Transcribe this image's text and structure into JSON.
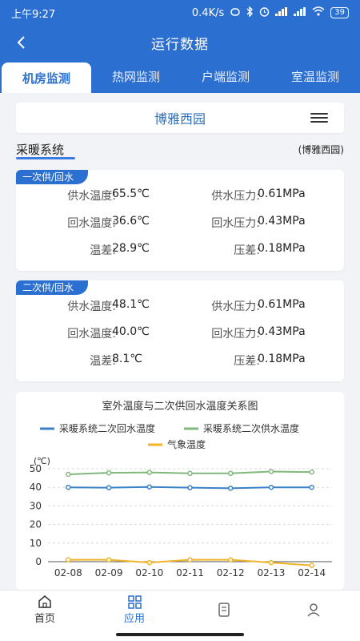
{
  "status": {
    "time": "上午9:27",
    "speed": "0.4K/s",
    "battery": "39"
  },
  "header": {
    "title": "运行数据"
  },
  "tabs": [
    {
      "label": "机房监测",
      "active": true
    },
    {
      "label": "热网监测",
      "active": false
    },
    {
      "label": "户端监测",
      "active": false
    },
    {
      "label": "室温监测",
      "active": false
    }
  ],
  "station": {
    "name": "博雅西园"
  },
  "section": {
    "title": "采暖系统",
    "station_tag": "(博雅西园)"
  },
  "primary": {
    "label": "一次供/回水",
    "supply_temp_label": "供水温度:",
    "supply_temp": "65.5℃",
    "supply_press_label": "供水压力:",
    "supply_press": "0.61MPa",
    "return_temp_label": "回水温度:",
    "return_temp": "36.6℃",
    "return_press_label": "回水压力:",
    "return_press": "0.43MPa",
    "diff_temp_label": "温差:",
    "diff_temp": "28.9℃",
    "diff_press_label": "压差:",
    "diff_press": "0.18MPa"
  },
  "secondary": {
    "label": "二次供/回水",
    "supply_temp_label": "供水温度:",
    "supply_temp": "48.1℃",
    "supply_press_label": "供水压力:",
    "supply_press": "0.61MPa",
    "return_temp_label": "回水温度:",
    "return_temp": "40.0℃",
    "return_press_label": "回水压力:",
    "return_press": "0.43MPa",
    "diff_temp_label": "温差:",
    "diff_temp": "8.1℃",
    "diff_press_label": "压差:",
    "diff_press": "0.18MPa"
  },
  "chart_data": {
    "type": "line",
    "title": "室外温度与二次供回水温度关系图",
    "ylabel": "(℃)",
    "xlabel": "",
    "x": [
      "02-08",
      "02-09",
      "02-10",
      "02-11",
      "02-12",
      "02-13",
      "02-14"
    ],
    "ylim": [
      0,
      50
    ],
    "yticks": [
      0,
      10,
      20,
      30,
      40,
      50
    ],
    "grid": true,
    "legend_position": "top",
    "series": [
      {
        "name": "采暖系统二次回水温度",
        "color": "#3a82c8",
        "values": [
          40,
          39.8,
          40.2,
          39.8,
          39.5,
          40,
          40
        ]
      },
      {
        "name": "采暖系统二次供水温度",
        "color": "#82b87d",
        "values": [
          47,
          47.8,
          48,
          47.5,
          47.5,
          48.5,
          48.2
        ]
      },
      {
        "name": "气象温度",
        "color": "#f0b428",
        "values": [
          1,
          1,
          -0.5,
          1,
          1,
          -0.5,
          -2
        ]
      }
    ]
  },
  "bottomnav": [
    {
      "label": "首页",
      "active": false
    },
    {
      "label": "应用",
      "active": true
    },
    {
      "label": "",
      "active": false
    },
    {
      "label": "",
      "active": false
    }
  ]
}
